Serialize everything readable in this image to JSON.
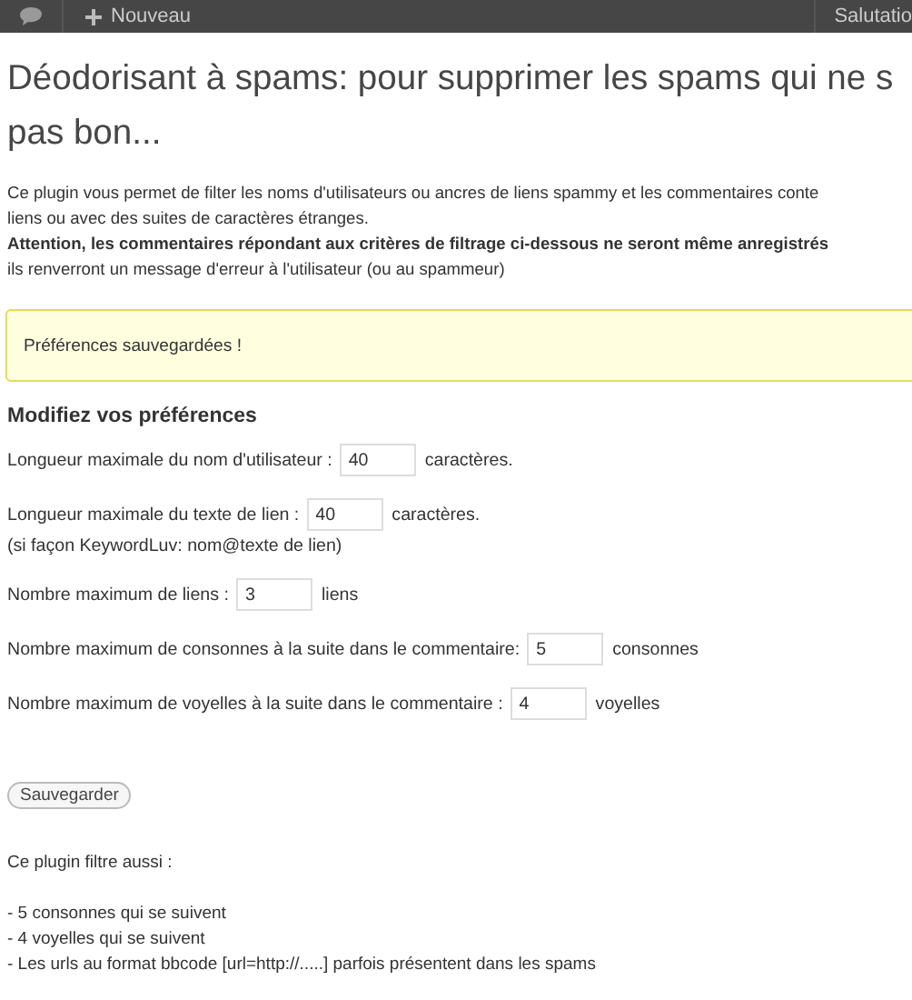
{
  "toolbar": {
    "new_label": "Nouveau",
    "account_label": "Salutatio"
  },
  "title_lines": [
    "Déodorisant à spams: pour supprimer les spams qui ne s",
    "pas bon..."
  ],
  "intro_lines": [
    {
      "text": "Ce plugin vous permet de filter les noms d'utilisateurs ou ancres de liens spammy et les commentaires conte",
      "bold": false
    },
    {
      "text": "liens ou avec des suites de caractères étranges.",
      "bold": false
    },
    {
      "text": "Attention, les commentaires répondant aux critères de filtrage ci-dessous ne seront même anregistrés",
      "bold": true
    },
    {
      "text": "ils renverront un message d'erreur à l'utilisateur (ou au spammeur)",
      "bold": false
    }
  ],
  "notice": "Préférences sauvegardées !",
  "form": {
    "heading": "Modifiez vos préférences",
    "fields": [
      {
        "label": "Longueur maximale du nom d'utilisateur :",
        "value": "40",
        "unit": "caractères."
      },
      {
        "label": "Longueur maximale du texte de lien :",
        "value": "40",
        "unit": "caractères.",
        "note": "(si façon KeywordLuv: nom@texte de lien)"
      },
      {
        "label": "Nombre maximum de liens :",
        "value": "3",
        "unit": "liens"
      },
      {
        "label": "Nombre maximum de consonnes à la suite dans le commentaire:",
        "value": "5",
        "unit": "consonnes"
      },
      {
        "label": "Nombre maximum de voyelles à la suite dans le commentaire :",
        "value": "4",
        "unit": "voyelles"
      }
    ],
    "save_button": "Sauvegarder"
  },
  "footer": {
    "intro": "Ce plugin filtre aussi :",
    "items": [
      "- 5 consonnes qui se suivent",
      "- 4 voyelles qui se suivent",
      "- Les urls au format bbcode [url=http://.....] parfois présentent dans les spams"
    ]
  }
}
